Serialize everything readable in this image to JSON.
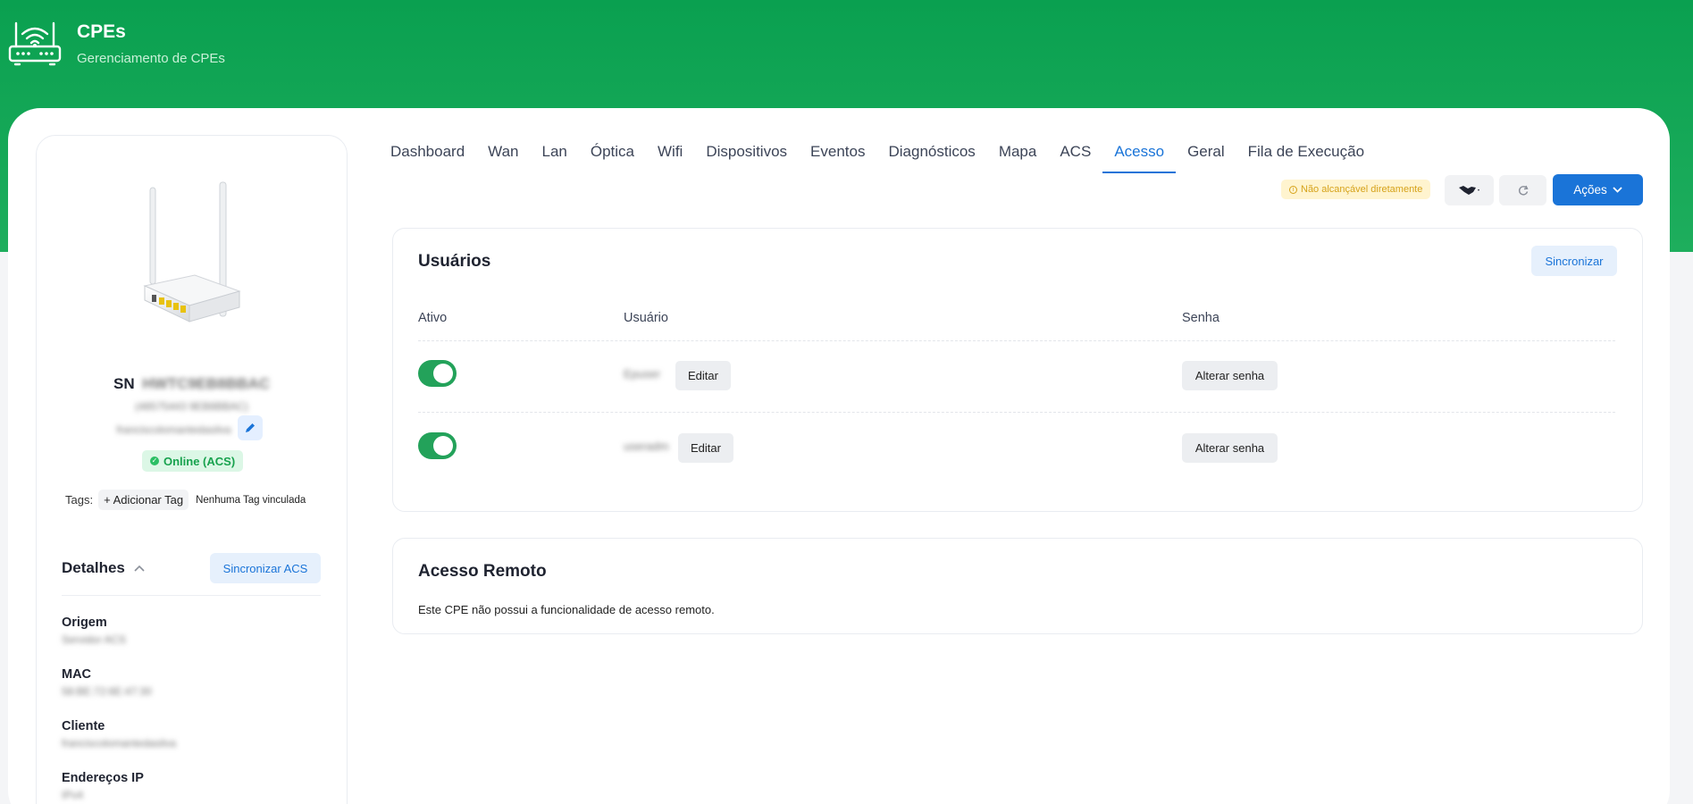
{
  "header": {
    "title": "CPEs",
    "subtitle": "Gerenciamento de CPEs",
    "icon": "router-wifi-icon"
  },
  "sidebar": {
    "sn_label": "SN",
    "sn_value": "HWTC9EB8BBAC",
    "secondary_id": "(48575443 9EB8BBAC)",
    "alias": "franciscolomantedasilva",
    "status": "Online (ACS)",
    "tags_label": "Tags:",
    "add_tag": "+ Adicionar Tag",
    "no_tag": "Nenhuma Tag vinculada",
    "details_title": "Detalhes",
    "sync_acs": "Sincronizar ACS",
    "details": [
      {
        "key": "Origem",
        "value": "Servidor ACS"
      },
      {
        "key": "MAC",
        "value": "58:BE:72:6E:47:30"
      },
      {
        "key": "Cliente",
        "value": "franciscolomantedasilva"
      },
      {
        "key": "Endereços IP",
        "value": "IPv4"
      }
    ]
  },
  "tabs": [
    "Dashboard",
    "Wan",
    "Lan",
    "Óptica",
    "Wifi",
    "Dispositivos",
    "Eventos",
    "Diagnósticos",
    "Mapa",
    "ACS",
    "Acesso",
    "Geral",
    "Fila de Execução"
  ],
  "active_tab": "Acesso",
  "toolbar": {
    "warning": "Não alcançável diretamente",
    "actions": "Ações"
  },
  "users_panel": {
    "title": "Usuários",
    "sync": "Sincronizar",
    "columns": [
      "Ativo",
      "Usuário",
      "Senha"
    ],
    "rows": [
      {
        "active": true,
        "user": "Epuser",
        "edit": "Editar",
        "password_action": "Alterar senha"
      },
      {
        "active": true,
        "user": "useradm",
        "edit": "Editar",
        "password_action": "Alterar senha"
      }
    ]
  },
  "remote_panel": {
    "title": "Acesso Remoto",
    "text": "Este CPE não possui a funcionalidade de acesso remoto."
  },
  "colors": {
    "brand_green": "#0aa050",
    "accent_blue": "#1a74d8",
    "toggle_on": "#23a25a"
  }
}
